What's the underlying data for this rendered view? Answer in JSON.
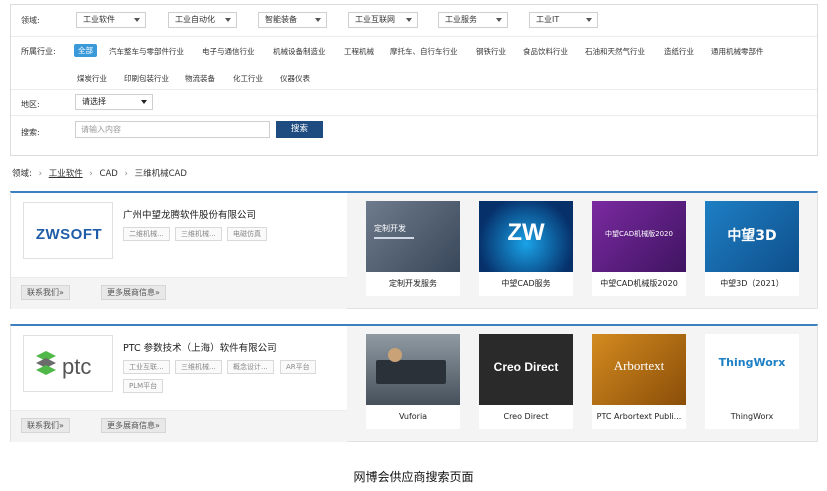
{
  "filters": {
    "domain_label": "领域:",
    "domain_selects": [
      "工业软件",
      "工业自动化",
      "智能装备",
      "工业互联网",
      "工业服务",
      "工业IT"
    ],
    "industry_label": "所属行业:",
    "industries_row1": [
      "全部",
      "汽车整车与零部件行业",
      "电子与通信行业",
      "机械设备制造业",
      "工程机械",
      "摩托车、自行车行业",
      "钢铁行业",
      "食品饮料行业",
      "石油和天然气行业",
      "造纸行业",
      "通用机械零部件"
    ],
    "industries_row2": [
      "煤炭行业",
      "印刷包装行业",
      "物流装备",
      "化工行业",
      "仪器仪表"
    ],
    "region_label": "地区:",
    "region_value": "请选择",
    "search_label": "搜索:",
    "search_placeholder": "请输入内容",
    "search_button": "搜索"
  },
  "breadcrumb": {
    "label": "领域:",
    "items": [
      "工业软件",
      "CAD",
      "三维机械CAD"
    ]
  },
  "companies": [
    {
      "name": "广州中望龙腾软件股份有限公司",
      "logo_text": "ZWSOFT",
      "tags": [
        "二维机械...",
        "三维机械...",
        "电磁仿真"
      ],
      "contact": "联系我们»",
      "more": "更多展商信息»",
      "products": [
        {
          "label": "定制开发服务",
          "img_text": "定制开发"
        },
        {
          "label": "中望CAD服务",
          "img_text": "ZW"
        },
        {
          "label": "中望CAD机械版2020",
          "img_text": "中望CAD机械版2020"
        },
        {
          "label": "中望3D（2021）",
          "img_text": "中望3D"
        }
      ]
    },
    {
      "name": "PTC 参数技术（上海）软件有限公司",
      "logo_text": "ptc",
      "tags": [
        "工业互联...",
        "三维机械...",
        "概念设计...",
        "AR平台",
        "PLM平台"
      ],
      "contact": "联系我们»",
      "more": "更多展商信息»",
      "products": [
        {
          "label": "Vuforia",
          "img_text": ""
        },
        {
          "label": "Creo Direct",
          "img_text": "Creo Direct"
        },
        {
          "label": "PTC Arbortext Publi...",
          "img_text": "Arbortext"
        },
        {
          "label": "ThingWorx",
          "img_text": "ThingWorx"
        }
      ]
    }
  ],
  "caption": "网博会供应商搜索页面",
  "colors": {
    "accent": "#3a9ad9",
    "primary_button": "#1f4c80",
    "card_border_top": "#3e7fc0"
  }
}
